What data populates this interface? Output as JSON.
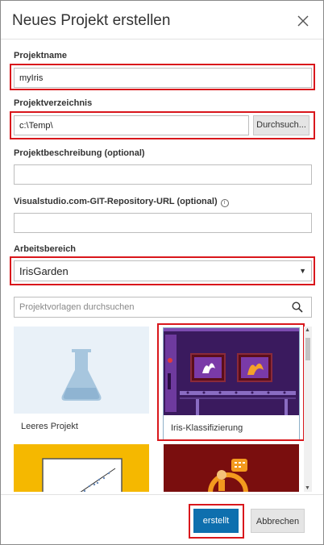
{
  "dialog": {
    "title": "Neues Projekt erstellen",
    "close_icon": "close-icon"
  },
  "form": {
    "project_name": {
      "label": "Projektname",
      "value": "myIris"
    },
    "project_dir": {
      "label": "Projektverzeichnis",
      "value": "c:\\Temp\\",
      "browse_label": "Durchsuch..."
    },
    "description": {
      "label": "Projektbeschreibung (optional)",
      "value": ""
    },
    "git_url": {
      "label": "Visualstudio.com-GIT-Repository-URL (optional)",
      "info_icon": "info-icon",
      "value": ""
    },
    "workspace": {
      "label": "Arbeitsbereich",
      "selected": "IrisGarden"
    },
    "search": {
      "placeholder": "Projektvorlagen durchsuchen",
      "icon": "search-icon"
    }
  },
  "templates": [
    {
      "name": "Leeres Projekt",
      "icon": "flask-icon",
      "selected": false
    },
    {
      "name": "Iris-Klassifizierung",
      "icon": "iris-conveyor-icon",
      "selected": true
    },
    {
      "name": "",
      "icon": "scatter-plot-icon",
      "selected": false
    },
    {
      "name": "",
      "icon": "person-bubble-icon",
      "selected": false
    }
  ],
  "footer": {
    "create_label": "erstellt",
    "cancel_label": "Abbrechen"
  },
  "colors": {
    "highlight": "#d9171c",
    "primary_button": "#0e6fae",
    "iris_bg": "#3a1a5e",
    "scatter_bg": "#f5b800",
    "person_bg": "#7a0e0e"
  }
}
